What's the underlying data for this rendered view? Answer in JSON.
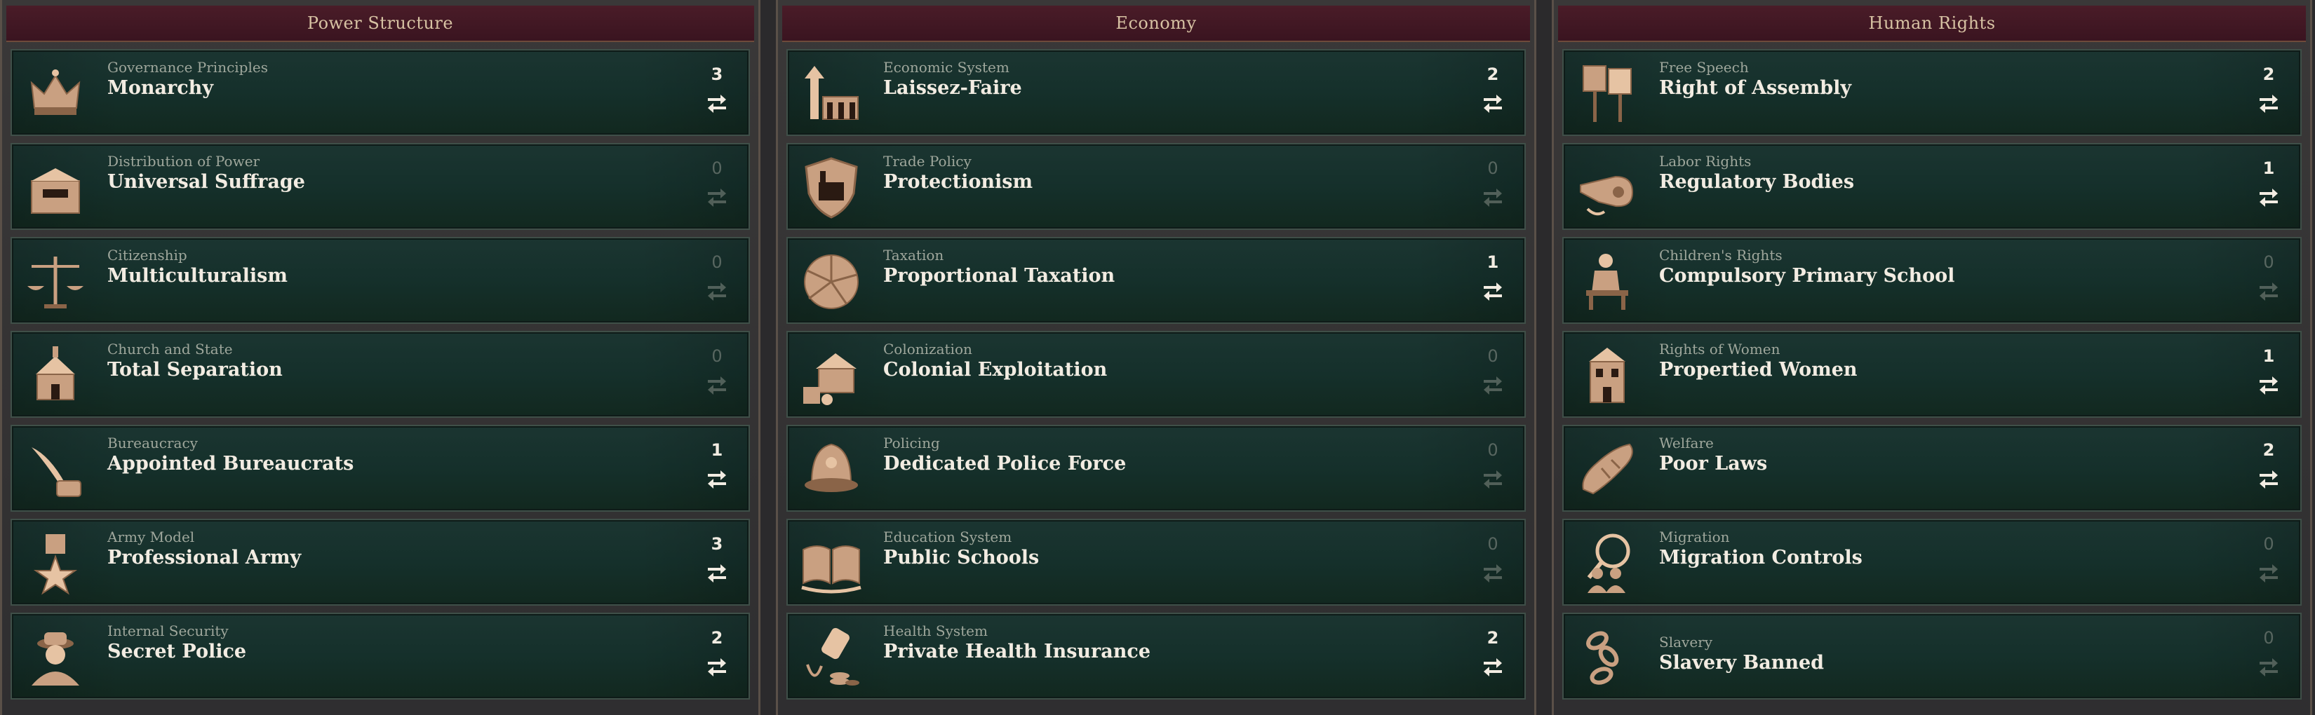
{
  "panels": [
    {
      "title": "Power Structure",
      "laws": [
        {
          "category": "Governance Principles",
          "value": "Monarchy",
          "count": "3",
          "icon": "crown-icon"
        },
        {
          "category": "Distribution of Power",
          "value": "Universal Suffrage",
          "count": "0",
          "icon": "ballot-box-icon"
        },
        {
          "category": "Citizenship",
          "value": "Multiculturalism",
          "count": "0",
          "icon": "scales-icon"
        },
        {
          "category": "Church and State",
          "value": "Total Separation",
          "count": "0",
          "icon": "church-icon"
        },
        {
          "category": "Bureaucracy",
          "value": "Appointed Bureaucrats",
          "count": "1",
          "icon": "quill-inkwell-icon"
        },
        {
          "category": "Army Model",
          "value": "Professional Army",
          "count": "3",
          "icon": "star-medal-icon"
        },
        {
          "category": "Internal Security",
          "value": "Secret Police",
          "count": "2",
          "icon": "spy-icon"
        }
      ]
    },
    {
      "title": "Economy",
      "laws": [
        {
          "category": "Economic System",
          "value": "Laissez-Faire",
          "count": "2",
          "icon": "factory-arrow-icon"
        },
        {
          "category": "Trade Policy",
          "value": "Protectionism",
          "count": "0",
          "icon": "factory-shield-icon"
        },
        {
          "category": "Taxation",
          "value": "Proportional Taxation",
          "count": "1",
          "icon": "pie-icon"
        },
        {
          "category": "Colonization",
          "value": "Colonial Exploitation",
          "count": "0",
          "icon": "house-goods-icon"
        },
        {
          "category": "Policing",
          "value": "Dedicated Police Force",
          "count": "0",
          "icon": "police-helmet-icon"
        },
        {
          "category": "Education System",
          "value": "Public Schools",
          "count": "0",
          "icon": "open-book-icon"
        },
        {
          "category": "Health System",
          "value": "Private Health Insurance",
          "count": "2",
          "icon": "medicine-coins-icon"
        }
      ]
    },
    {
      "title": "Human Rights",
      "laws": [
        {
          "category": "Free Speech",
          "value": "Right of Assembly",
          "count": "2",
          "icon": "placards-icon"
        },
        {
          "category": "Labor Rights",
          "value": "Regulatory Bodies",
          "count": "1",
          "icon": "whistle-icon"
        },
        {
          "category": "Children's Rights",
          "value": "Compulsory Primary School",
          "count": "0",
          "icon": "school-desk-icon"
        },
        {
          "category": "Rights of Women",
          "value": "Propertied Women",
          "count": "1",
          "icon": "townhouse-icon"
        },
        {
          "category": "Welfare",
          "value": "Poor Laws",
          "count": "2",
          "icon": "bread-icon"
        },
        {
          "category": "Migration",
          "value": "Migration Controls",
          "count": "0",
          "icon": "magnifier-people-icon"
        },
        {
          "category": "Slavery",
          "value": "Slavery Banned",
          "count": "0",
          "icon": "broken-chain-icon"
        }
      ]
    }
  ],
  "colors": {
    "header_bg": "#4a1c28",
    "row_bg": "#15302b",
    "icon_bronze": "#c9a081",
    "text_primary": "#f2ece2",
    "text_secondary": "#9fa79c"
  }
}
